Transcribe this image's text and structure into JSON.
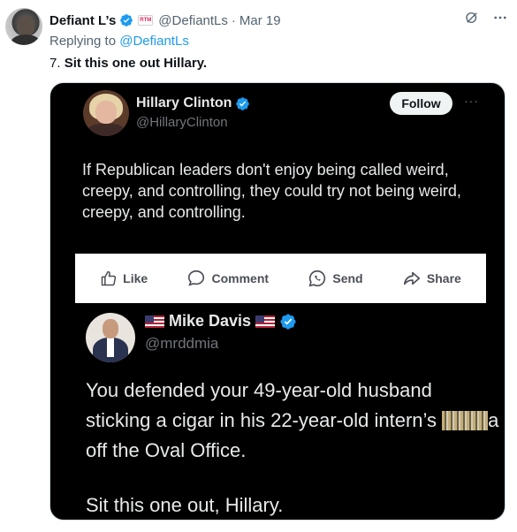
{
  "tweet": {
    "author_name": "Defiant L’s",
    "affiliation_label": "RTM",
    "handle": "@DefiantLs",
    "separator": "·",
    "date": "Mar 19",
    "replying_prefix": "Replying to",
    "replying_to": "@DefiantLs",
    "text_number": "7.",
    "text_body": "Sit this one out Hillary."
  },
  "embedded": {
    "hillary": {
      "name": "Hillary Clinton",
      "handle": "@HillaryClinton",
      "follow_label": "Follow",
      "more_label": "···",
      "text": "If Republican leaders don't enjoy being called weird, creepy, and controlling, they could try not being weird, creepy, and controlling."
    },
    "actions": {
      "like": "Like",
      "comment": "Comment",
      "send": "Send",
      "share": "Share"
    },
    "davis": {
      "name": "Mike Davis",
      "handle": "@mrddmia",
      "text_before": "You defended your 49-year-old husband sticking a cigar in his 22-year-old intern’s",
      "text_after": "a off the Oval Office.",
      "closing": "Sit this one out, Hillary."
    }
  },
  "icons": {
    "verified": "verified-badge-icon",
    "grok": "grok-icon",
    "more": "more-icon",
    "flag": "us-flag-icon"
  },
  "colors": {
    "accent": "#1d9bf0",
    "text": "#0f1419",
    "muted": "#536471"
  }
}
